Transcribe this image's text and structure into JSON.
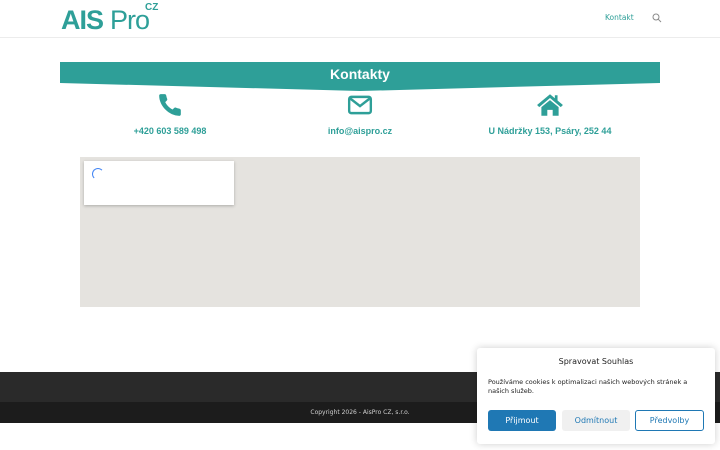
{
  "header": {
    "logo_ais": "AIS",
    "logo_pro": "Pro",
    "logo_cz": "CZ",
    "nav_kontakt": "Kontakt",
    "search_icon": "search-icon"
  },
  "banner": {
    "title": "Kontakty"
  },
  "contacts": [
    {
      "icon": "phone-icon",
      "label": "+420 603 589 498"
    },
    {
      "icon": "envelope-icon",
      "label": "info@aispro.cz"
    },
    {
      "icon": "home-icon",
      "label": "U Nádržky 153, Psáry, 252 44"
    }
  ],
  "footer": {
    "copyright": "Copyright 2026 - AisPro CZ, s.r.o."
  },
  "cookie": {
    "title": "Spravovat Souhlas",
    "text": "Používáme cookies k optimalizaci našich webových stránek a našich služeb.",
    "accept": "Přijmout",
    "deny": "Odmítnout",
    "prefs": "Předvolby"
  },
  "colors": {
    "accent": "#2e9f98",
    "button_blue": "#1f78b4",
    "footer_dark": "#2a2a2a"
  }
}
